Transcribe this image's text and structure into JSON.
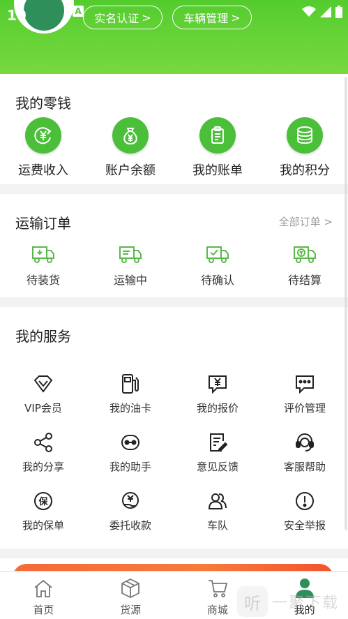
{
  "status_bar": {
    "time": "10"
  },
  "header": {
    "verify_button": "实名认证",
    "vehicle_button": "车辆管理",
    "chevron": ">",
    "status_badge": "A"
  },
  "wallet": {
    "title": "我的零钱",
    "items": [
      {
        "label": "运费收入",
        "icon": "freight-income-icon"
      },
      {
        "label": "账户余额",
        "icon": "money-bag-icon"
      },
      {
        "label": "我的账单",
        "icon": "clipboard-icon"
      },
      {
        "label": "我的积分",
        "icon": "coins-stack-icon"
      }
    ]
  },
  "orders": {
    "title": "运输订单",
    "all_link": "全部订单 >",
    "items": [
      {
        "label": "待装货",
        "icon": "truck-load-icon"
      },
      {
        "label": "运输中",
        "icon": "truck-moving-icon"
      },
      {
        "label": "待确认",
        "icon": "truck-check-icon"
      },
      {
        "label": "待结算",
        "icon": "truck-settle-icon"
      }
    ]
  },
  "services": {
    "title": "我的服务",
    "items": [
      {
        "label": "VIP会员",
        "icon": "diamond-icon"
      },
      {
        "label": "我的油卡",
        "icon": "fuel-pump-icon"
      },
      {
        "label": "我的报价",
        "icon": "quote-icon"
      },
      {
        "label": "评价管理",
        "icon": "comment-icon"
      },
      {
        "label": "我的分享",
        "icon": "share-icon"
      },
      {
        "label": "我的助手",
        "icon": "robot-icon"
      },
      {
        "label": "意见反馈",
        "icon": "feedback-icon"
      },
      {
        "label": "客服帮助",
        "icon": "headset-icon"
      },
      {
        "label": "我的保单",
        "icon": "insurance-icon"
      },
      {
        "label": "委托收款",
        "icon": "hand-money-icon"
      },
      {
        "label": "车队",
        "icon": "team-icon"
      },
      {
        "label": "安全举报",
        "icon": "alert-icon"
      }
    ]
  },
  "tabbar": {
    "tabs": [
      {
        "label": "首页",
        "icon": "home-icon"
      },
      {
        "label": "货源",
        "icon": "box-icon"
      },
      {
        "label": "商城",
        "icon": "cart-icon"
      },
      {
        "label": "我的",
        "icon": "person-icon",
        "active": true
      }
    ]
  },
  "watermark": {
    "text": "一聚下载",
    "glyph": "听"
  },
  "colors": {
    "brand_green": "#54cc2e",
    "icon_green": "#4cbf3a",
    "truck_green": "#5ab84a"
  }
}
